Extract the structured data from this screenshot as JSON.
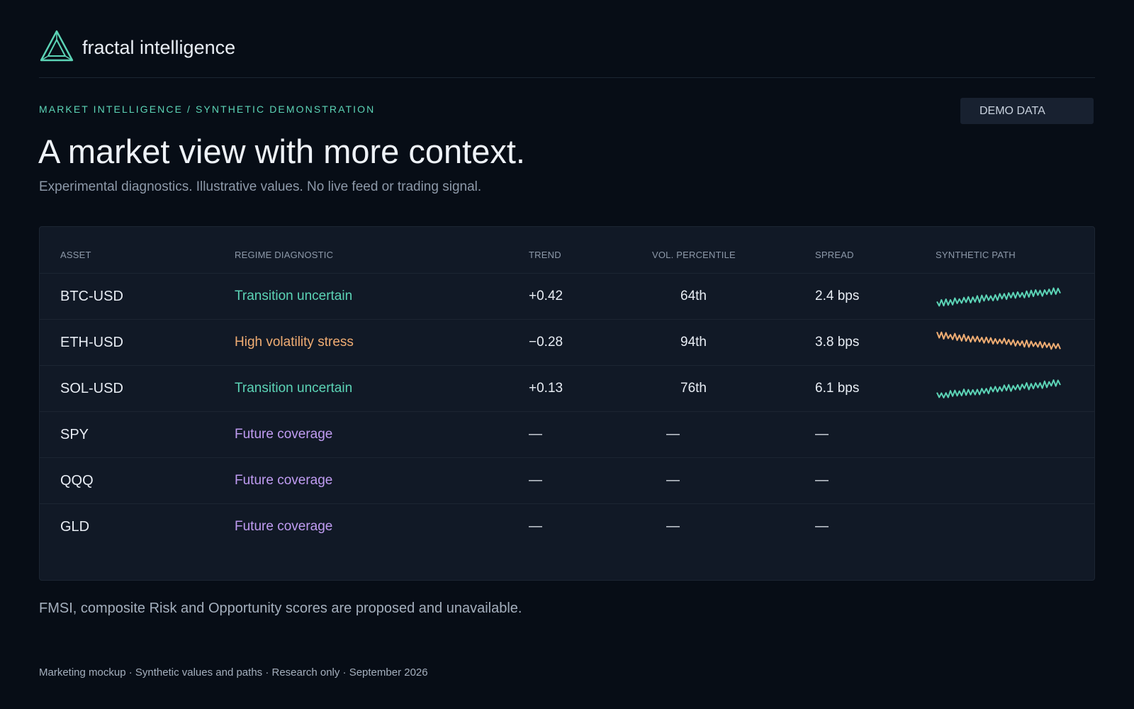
{
  "brand": {
    "name": "fractal intelligence",
    "logo_icon": "triangle-logo-icon",
    "accent": "#5cd4b6"
  },
  "eyebrow": "MARKET INTELLIGENCE / SYNTHETIC DEMONSTRATION",
  "badge": "DEMO DATA",
  "title": "A market view with more context.",
  "subtitle": "Experimental diagnostics. Illustrative values. No live feed or trading signal.",
  "table": {
    "columns": [
      "ASSET",
      "REGIME DIAGNOSTIC",
      "TREND",
      "VOL. PERCENTILE",
      "SPREAD",
      "SYNTHETIC PATH"
    ],
    "rows": [
      {
        "asset": "BTC-USD",
        "regime": "Transition uncertain",
        "regime_color": "#5cd4b6",
        "trend": "+0.42",
        "vol": "64th",
        "spread": "2.4 bps",
        "path": {
          "color": "#5cd4b6",
          "direction": "up"
        }
      },
      {
        "asset": "ETH-USD",
        "regime": "High volatility stress",
        "regime_color": "#f0ad73",
        "trend": "−0.28",
        "vol": "94th",
        "spread": "3.8 bps",
        "path": {
          "color": "#f0ad73",
          "direction": "down"
        }
      },
      {
        "asset": "SOL-USD",
        "regime": "Transition uncertain",
        "regime_color": "#5cd4b6",
        "trend": "+0.13",
        "vol": "76th",
        "spread": "6.1 bps",
        "path": {
          "color": "#5cd4b6",
          "direction": "up"
        }
      },
      {
        "asset": "SPY",
        "regime": "Future coverage",
        "regime_color": "#c09cf2",
        "trend": "—",
        "vol": "—",
        "spread": "—",
        "path": null
      },
      {
        "asset": "QQQ",
        "regime": "Future coverage",
        "regime_color": "#c09cf2",
        "trend": "—",
        "vol": "—",
        "spread": "—",
        "path": null
      },
      {
        "asset": "GLD",
        "regime": "Future coverage",
        "regime_color": "#c09cf2",
        "trend": "—",
        "vol": "—",
        "spread": "—",
        "path": null
      }
    ]
  },
  "footnote": "FMSI, composite Risk and Opportunity scores are proposed and unavailable.",
  "footer": "Marketing mockup · Synthetic values and paths · Research only · September 2026"
}
